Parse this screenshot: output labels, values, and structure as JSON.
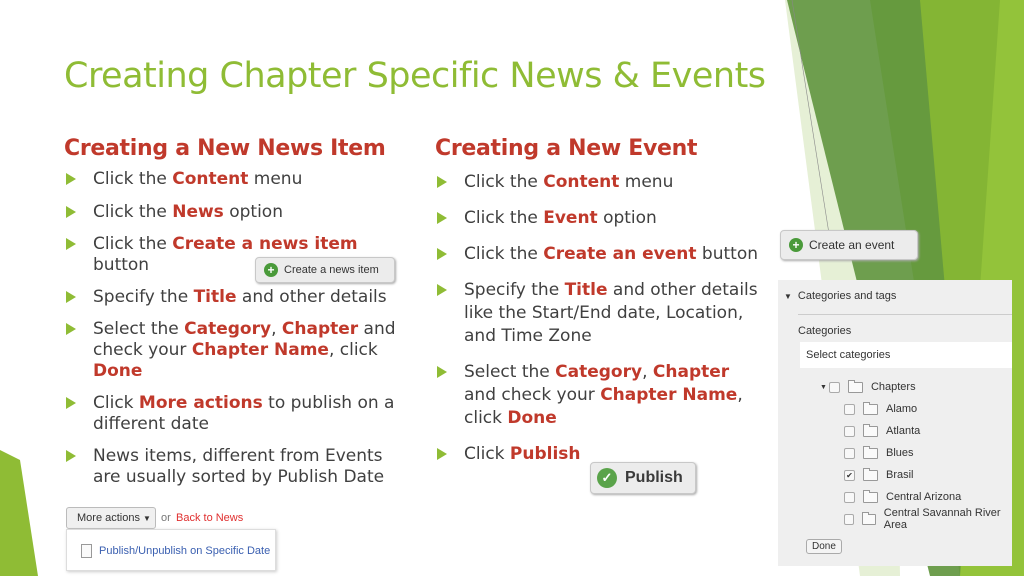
{
  "slide": {
    "title": "Creating Chapter Specific News & Events",
    "accent_color": "#8fbc35",
    "highlight_color": "#c0392b"
  },
  "news": {
    "heading": "Creating  a New News Item",
    "bullets": [
      {
        "parts": [
          {
            "t": "Click the "
          },
          {
            "t": "Content",
            "h": true
          },
          {
            "t": " menu"
          }
        ]
      },
      {
        "parts": [
          {
            "t": "Click the "
          },
          {
            "t": "News",
            "h": true
          },
          {
            "t": " option"
          }
        ]
      },
      {
        "parts": [
          {
            "t": "Click the "
          },
          {
            "t": "Create a news item",
            "h": true
          },
          {
            "t": " button"
          }
        ]
      },
      {
        "parts": [
          {
            "t": "Specify the "
          },
          {
            "t": "Title",
            "h": true
          },
          {
            "t": " and other details"
          }
        ]
      },
      {
        "parts": [
          {
            "t": "Select the "
          },
          {
            "t": "Category",
            "h": true
          },
          {
            "t": ", "
          },
          {
            "t": "Chapter",
            "h": true
          },
          {
            "t": " and check your "
          },
          {
            "t": "Chapter Name",
            "h": true
          },
          {
            "t": ", click "
          },
          {
            "t": "Done",
            "h": true
          }
        ]
      },
      {
        "parts": [
          {
            "t": "Click "
          },
          {
            "t": "More actions",
            "h": true
          },
          {
            "t": " to publish on a different date"
          }
        ]
      },
      {
        "parts": [
          {
            "t": "News items, different from Events are usually sorted by Publish Date"
          }
        ]
      }
    ],
    "create_button": "Create a news item",
    "more_actions_button": "More actions",
    "or_text": "or",
    "back_link": "Back to News",
    "menu_item": "Publish/Unpublish on Specific Date"
  },
  "event": {
    "heading": "Creating a New Event",
    "bullets": [
      {
        "parts": [
          {
            "t": "Click the "
          },
          {
            "t": "Content",
            "h": true
          },
          {
            "t": " menu"
          }
        ]
      },
      {
        "parts": [
          {
            "t": "Click the "
          },
          {
            "t": "Event",
            "h": true
          },
          {
            "t": " option"
          }
        ]
      },
      {
        "parts": [
          {
            "t": "Click the "
          },
          {
            "t": "Create an event",
            "h": true
          },
          {
            "t": " button"
          }
        ]
      },
      {
        "parts": [
          {
            "t": "Specify the "
          },
          {
            "t": "Title",
            "h": true
          },
          {
            "t": " and other details like the Start/End date, Location, and Time Zone"
          }
        ]
      },
      {
        "parts": [
          {
            "t": "Select the "
          },
          {
            "t": "Category",
            "h": true
          },
          {
            "t": ", "
          },
          {
            "t": "Chapter",
            "h": true
          },
          {
            "t": " and check your "
          },
          {
            "t": "Chapter Name",
            "h": true
          },
          {
            "t": ", click "
          },
          {
            "t": "Done",
            "h": true
          }
        ]
      },
      {
        "parts": [
          {
            "t": "Click "
          },
          {
            "t": "Publish",
            "h": true
          }
        ]
      }
    ],
    "create_button": "Create an event",
    "publish_button": "Publish"
  },
  "categories_panel": {
    "section_title": "Categories and tags",
    "label": "Categories",
    "select_placeholder": "Select categories",
    "parent": "Chapters",
    "items": [
      {
        "name": "Alamo",
        "checked": false
      },
      {
        "name": "Atlanta",
        "checked": false
      },
      {
        "name": "Blues",
        "checked": false
      },
      {
        "name": "Brasil",
        "checked": true
      },
      {
        "name": "Central Arizona",
        "checked": false
      },
      {
        "name": "Central Savannah River Area",
        "checked": false
      }
    ],
    "done_button": "Done"
  }
}
